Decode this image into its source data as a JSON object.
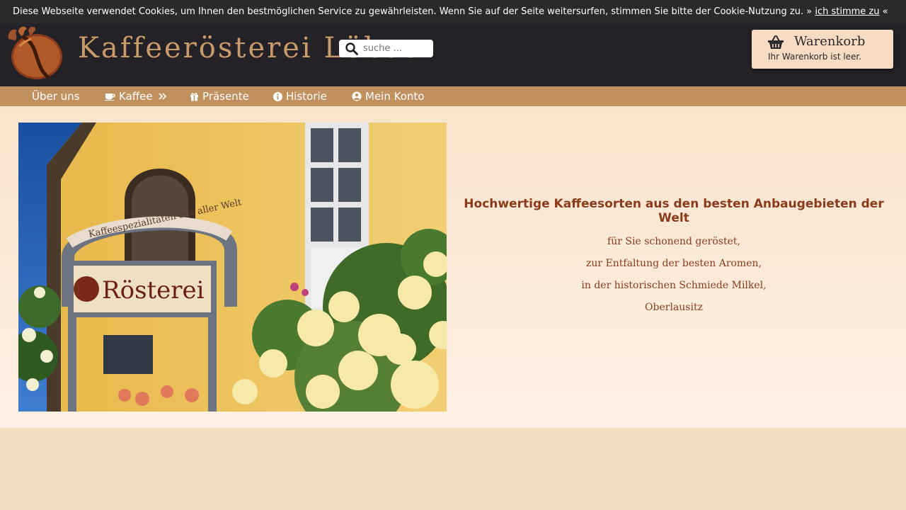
{
  "cookie_banner": {
    "message": "Diese Webseite verwendet Cookies, um Ihnen den bestmöglichen Service zu gewährleisten. Wenn Sie auf der Seite weitersurfen, stimmen Sie bitte der Cookie-Nutzung zu. »",
    "agree_link": "ich stimme zu",
    "suffix": "«"
  },
  "header": {
    "site_name": "Kaffeerösterei Löbau",
    "search_placeholder": "suche ..."
  },
  "cart": {
    "title": "Warenkorb",
    "status": "Ihr Warenkorb ist leer."
  },
  "nav": {
    "items": [
      {
        "label": "Über uns",
        "icon": ""
      },
      {
        "label": "Kaffee",
        "icon": "coffee-cup-icon",
        "trailing_icon": "double-chevron-right-icon"
      },
      {
        "label": "Präsente",
        "icon": "gift-icon"
      },
      {
        "label": "Historie",
        "icon": "info-icon"
      },
      {
        "label": "Mein Konto",
        "icon": "user-circle-icon"
      }
    ]
  },
  "hero": {
    "headline": "Hochwertige Kaffeesorten aus den besten Anbaugebieten der Welt",
    "lines": [
      "für Sie schonend geröstet,",
      "zur Entfaltung der besten Aromen,",
      "in der historischen Schmiede Milkel,",
      "Oberlausitz"
    ],
    "photo": {
      "sign_arch_text": "Kaffeespezialitäten aus aller Welt",
      "sign_text": "Rösterei"
    }
  },
  "colors": {
    "cookie_bar": "#2b292c",
    "header": "#242226",
    "nav": "#c0905e",
    "accent_text": "#8b3a1a",
    "logo_text": "#c99a6a",
    "cart_bg": "#f5dcc2"
  }
}
